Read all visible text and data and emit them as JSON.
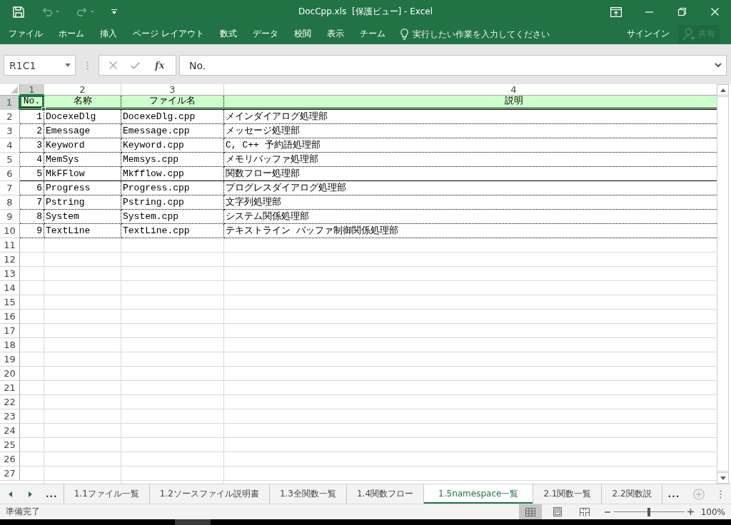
{
  "window": {
    "title": "DocCpp.xls  [保護ビュー] - Excel"
  },
  "quick_access": [
    {
      "kind": "save",
      "disabled": false
    },
    {
      "kind": "undo",
      "disabled": true
    },
    {
      "kind": "redo",
      "disabled": true
    },
    {
      "kind": "customize",
      "disabled": false
    }
  ],
  "ribbon": {
    "tabs": [
      {
        "label": "ファイル",
        "selected": false
      },
      {
        "label": "ホーム",
        "selected": false
      },
      {
        "label": "挿入",
        "selected": false
      },
      {
        "label": "ページ レイアウト",
        "selected": false
      },
      {
        "label": "数式",
        "selected": false
      },
      {
        "label": "データ",
        "selected": false
      },
      {
        "label": "校閲",
        "selected": false
      },
      {
        "label": "表示",
        "selected": false
      },
      {
        "label": "チーム",
        "selected": false
      }
    ],
    "tell_me": {
      "placeholder": "実行したい作業を入力してください"
    },
    "sign_in": "サインイン",
    "share": {
      "label": "共有",
      "disabled": true
    }
  },
  "formula_bar": {
    "name_box": "R1C1",
    "function_label": "fx",
    "value": "No."
  },
  "sheet": {
    "columns": [
      {
        "label": "1",
        "selected": true
      },
      {
        "label": "2",
        "selected": false
      },
      {
        "label": "3",
        "selected": false
      },
      {
        "label": "4",
        "selected": false
      }
    ],
    "row_headers": [
      {
        "label": "1",
        "selected": true
      },
      {
        "label": "2",
        "selected": false
      },
      {
        "label": "3",
        "selected": false
      },
      {
        "label": "4",
        "selected": false
      },
      {
        "label": "5",
        "selected": false
      },
      {
        "label": "6",
        "selected": false
      },
      {
        "label": "7",
        "selected": false
      },
      {
        "label": "8",
        "selected": false
      },
      {
        "label": "9",
        "selected": false
      },
      {
        "label": "10",
        "selected": false
      },
      {
        "label": "11",
        "selected": false
      },
      {
        "label": "12",
        "selected": false
      },
      {
        "label": "13",
        "selected": false
      },
      {
        "label": "14",
        "selected": false
      },
      {
        "label": "15",
        "selected": false
      },
      {
        "label": "16",
        "selected": false
      },
      {
        "label": "17",
        "selected": false
      },
      {
        "label": "18",
        "selected": false
      },
      {
        "label": "19",
        "selected": false
      },
      {
        "label": "20",
        "selected": false
      },
      {
        "label": "21",
        "selected": false
      },
      {
        "label": "22",
        "selected": false
      },
      {
        "label": "23",
        "selected": false
      },
      {
        "label": "24",
        "selected": false
      },
      {
        "label": "25",
        "selected": false
      },
      {
        "label": "26",
        "selected": false
      },
      {
        "label": "27",
        "selected": false
      }
    ],
    "rows": [
      {
        "kind": "header",
        "double_rule_below": true,
        "solid_rule_below": false,
        "cells": [
          "No.",
          "名称",
          "ファイル名",
          "説明"
        ]
      },
      {
        "kind": "data",
        "double_rule_below": false,
        "solid_rule_below": false,
        "cells": [
          "1",
          "DocexeDlg",
          "DocexeDlg.cpp",
          "メインダイアログ処理部"
        ]
      },
      {
        "kind": "data",
        "double_rule_below": false,
        "solid_rule_below": false,
        "cells": [
          "2",
          "Emessage",
          "Emessage.cpp",
          "メッセージ処理部"
        ]
      },
      {
        "kind": "data",
        "double_rule_below": false,
        "solid_rule_below": false,
        "cells": [
          "3",
          "Keyword",
          "Keyword.cpp",
          "C, C++ 予約語処理部"
        ]
      },
      {
        "kind": "data",
        "double_rule_below": false,
        "solid_rule_below": false,
        "cells": [
          "4",
          "MemSys",
          "Memsys.cpp",
          "メモリバッファ処理部"
        ]
      },
      {
        "kind": "data",
        "double_rule_below": false,
        "solid_rule_below": true,
        "cells": [
          "5",
          "MkFFlow",
          "Mkfflow.cpp",
          "関数フロー処理部"
        ]
      },
      {
        "kind": "data",
        "double_rule_below": false,
        "solid_rule_below": false,
        "cells": [
          "6",
          "Progress",
          "Progress.cpp",
          "プログレスダイアログ処理部"
        ]
      },
      {
        "kind": "data",
        "double_rule_below": false,
        "solid_rule_below": false,
        "cells": [
          "7",
          "Pstring",
          "Pstring.cpp",
          "文字列処理部"
        ]
      },
      {
        "kind": "data",
        "double_rule_below": false,
        "solid_rule_below": false,
        "cells": [
          "8",
          "System",
          "System.cpp",
          "システム関係処理部"
        ]
      },
      {
        "kind": "data",
        "double_rule_below": false,
        "solid_rule_below": false,
        "cells": [
          "9",
          "TextLine",
          "TextLine.cpp",
          "テキストライン バッファ制御関係処理部"
        ]
      }
    ]
  },
  "sheet_tabs": {
    "more_left": "...",
    "tabs": [
      {
        "label": "1.1ファイル一覧",
        "selected": false
      },
      {
        "label": "1.2ソースファイル説明書",
        "selected": false
      },
      {
        "label": "1.3全関数一覧",
        "selected": false
      },
      {
        "label": "1.4関数フロー",
        "selected": false
      },
      {
        "label": "1.5namespace一覧",
        "selected": true
      },
      {
        "label": "2.1関数一覧",
        "selected": false
      },
      {
        "label": "2.2関数説",
        "selected": false
      }
    ],
    "more_right": "..."
  },
  "status_bar": {
    "status": "準備完了",
    "views": [
      {
        "kind": "normal",
        "selected": true
      },
      {
        "kind": "page_layout",
        "selected": false
      },
      {
        "kind": "page_break",
        "selected": false
      }
    ],
    "zoom": {
      "level": 0.5,
      "reading": "100%"
    }
  }
}
